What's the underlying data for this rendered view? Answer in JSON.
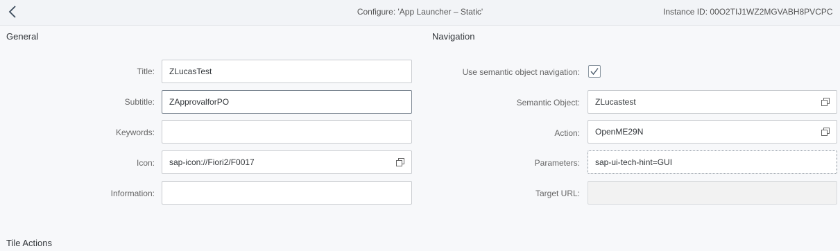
{
  "header": {
    "back_icon": "chevron-left-icon",
    "title": "Configure: 'App Launcher – Static'",
    "instance": "Instance ID: 00O2TIJ1WZ2MGVABH8PVCPC"
  },
  "general": {
    "section_title": "General",
    "title_label": "Title:",
    "title_value": "ZLucasTest",
    "subtitle_label": "Subtitle:",
    "subtitle_value": "ZApprovalforPO",
    "keywords_label": "Keywords:",
    "keywords_value": "",
    "icon_label": "Icon:",
    "icon_value": "sap-icon://Fiori2/F0017",
    "information_label": "Information:",
    "information_value": ""
  },
  "navigation": {
    "section_title": "Navigation",
    "semantic_nav_label": "Use semantic object navigation:",
    "semantic_nav_checked": true,
    "semantic_object_label": "Semantic Object:",
    "semantic_object_value": "ZLucastest",
    "action_label": "Action:",
    "action_value": "OpenME29N",
    "parameters_label": "Parameters:",
    "parameters_value": "sap-ui-tech-hint=GUI",
    "target_url_label": "Target URL:",
    "target_url_value": ""
  },
  "tile_actions": {
    "section_title": "Tile Actions"
  },
  "colors": {
    "background": "#f7f8fa",
    "header": "#f2f4f7",
    "field_border": "#c8cbcf",
    "label": "#666666"
  }
}
